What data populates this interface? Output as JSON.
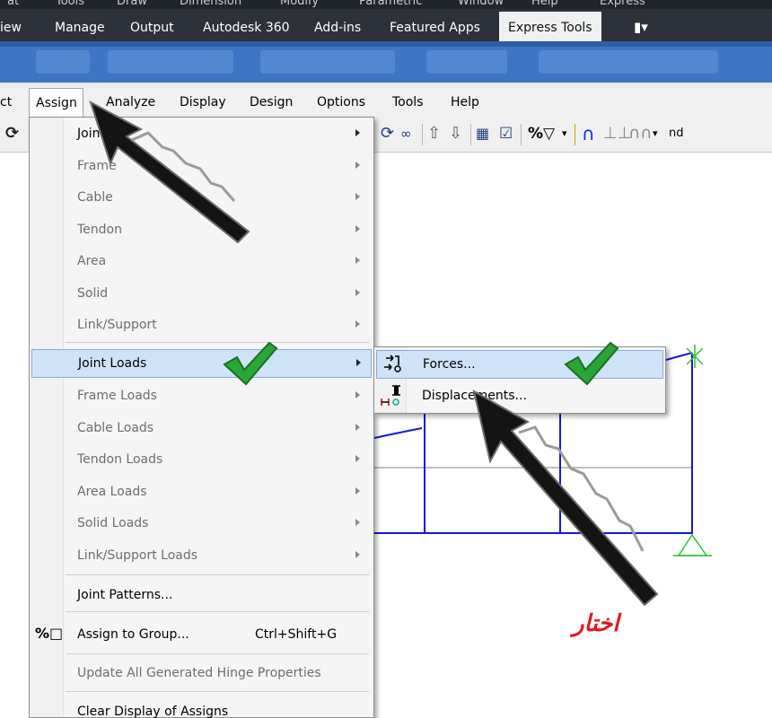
{
  "autocad": {
    "top_strip": [
      "at",
      "Tools",
      "Draw",
      "Dimension",
      "Modify",
      "Parametric",
      "Window",
      "Help",
      "Express"
    ],
    "tabs": [
      "iew",
      "Manage",
      "Output",
      "Autodesk 360",
      "Add-ins",
      "Featured Apps",
      "Express Tools"
    ],
    "active_tab": "Express Tools",
    "extra_tab_icon": "camera-icon"
  },
  "menubar": {
    "items": [
      "ct",
      "Assign",
      "Analyze",
      "Display",
      "Design",
      "Options",
      "Tools",
      "Help"
    ],
    "open_item": "Assign"
  },
  "toolbar": {
    "trailing_text": "nd"
  },
  "assign_menu": {
    "items": [
      {
        "label": "Joint",
        "state": "enabled",
        "submenu": true
      },
      {
        "label": "Frame",
        "state": "disabled",
        "submenu": true
      },
      {
        "label": "Cable",
        "state": "disabled",
        "submenu": true
      },
      {
        "label": "Tendon",
        "state": "disabled",
        "submenu": true
      },
      {
        "label": "Area",
        "state": "disabled",
        "submenu": true
      },
      {
        "label": "Solid",
        "state": "disabled",
        "submenu": true
      },
      {
        "label": "Link/Support",
        "state": "disabled",
        "submenu": true
      },
      {
        "label": "Joint Loads",
        "state": "highlighted",
        "submenu": true
      },
      {
        "label": "Frame Loads",
        "state": "disabled",
        "submenu": true
      },
      {
        "label": "Cable Loads",
        "state": "disabled",
        "submenu": true
      },
      {
        "label": "Tendon Loads",
        "state": "disabled",
        "submenu": true
      },
      {
        "label": "Area Loads",
        "state": "disabled",
        "submenu": true
      },
      {
        "label": "Solid Loads",
        "state": "disabled",
        "submenu": true
      },
      {
        "label": "Link/Support Loads",
        "state": "disabled",
        "submenu": true
      },
      {
        "label": "Joint Patterns...",
        "state": "enabled",
        "submenu": false
      },
      {
        "label": "Assign to Group...",
        "state": "enabled",
        "submenu": false,
        "shortcut": "Ctrl+Shift+G",
        "icon": "assign-group-icon"
      },
      {
        "label": "Update All Generated Hinge Properties",
        "state": "disabled",
        "submenu": false
      },
      {
        "label": "Clear Display of Assigns",
        "state": "enabled",
        "submenu": false
      }
    ]
  },
  "joint_loads_submenu": {
    "items": [
      {
        "label": "Forces...",
        "state": "highlighted",
        "icon": "joint-force-icon"
      },
      {
        "label": "Displacements...",
        "state": "enabled",
        "icon": "joint-displacement-icon"
      }
    ]
  },
  "annotation": {
    "text": "اختار",
    "color": "#e2191b",
    "check_color": "#2aa635"
  },
  "colors": {
    "frame_line": "#1515e0",
    "support": "#2bc42b",
    "highlight": "#cfe3f8",
    "highlight_border": "#84acdd"
  }
}
